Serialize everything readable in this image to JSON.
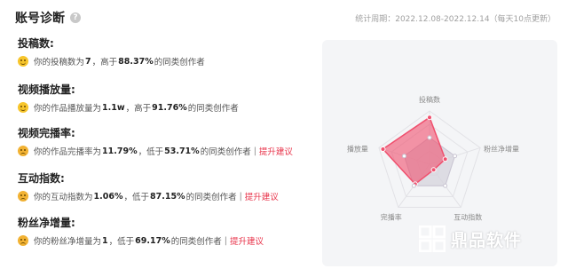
{
  "header": {
    "title": "账号诊断",
    "period": "统计周期：2022.12.08-2022.12.14（每天10点更新）"
  },
  "metrics": [
    {
      "name": "投稿数:",
      "pre": "你的投稿数为",
      "value": "7",
      "mid": "，高于",
      "pct": "88.37%",
      "post": "的同类创作者",
      "mood": "happy",
      "suggest": ""
    },
    {
      "name": "视频播放量:",
      "pre": "你的作品播放量为",
      "value": "1.1w",
      "mid": "，高于",
      "pct": "91.76%",
      "post": "的同类创作者",
      "mood": "happy",
      "suggest": ""
    },
    {
      "name": "视频完播率:",
      "pre": "你的作品完播率为",
      "value": "11.79%",
      "mid": "，低于",
      "pct": "53.71%",
      "post": "的同类创作者",
      "mood": "sad",
      "suggest": "提升建议"
    },
    {
      "name": "互动指数:",
      "pre": "你的互动指数为",
      "value": "1.06%",
      "mid": "，低于",
      "pct": "87.15%",
      "post": "的同类创作者",
      "mood": "sad",
      "suggest": "提升建议"
    },
    {
      "name": "粉丝净增量:",
      "pre": "你的粉丝净增量为",
      "value": "1",
      "mid": "，低于",
      "pct": "69.17%",
      "post": "的同类创作者",
      "mood": "sad",
      "suggest": "提升建议"
    }
  ],
  "radar": {
    "axes": [
      "投稿数",
      "粉丝净增量",
      "互动指数",
      "完播率",
      "播放量"
    ],
    "user_values": [
      0.88,
      0.31,
      0.13,
      0.46,
      0.92
    ],
    "peer_values": [
      0.5,
      0.5,
      0.5,
      0.5,
      0.5
    ],
    "user_color": "#f0506e",
    "peer_color": "#d6d3dc"
  },
  "brand": {
    "name": "鼎品软件"
  }
}
